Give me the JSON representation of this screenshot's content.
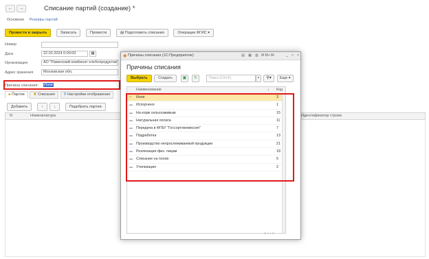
{
  "window": {
    "title": "Списание партий (создание) *",
    "tabs": [
      "Основное",
      "Резервы партий"
    ]
  },
  "toolbar": {
    "post_close": "Провести и закрыть",
    "save": "Записать",
    "post": "Провести",
    "prepare": "Подготовить списания",
    "fgis": "Операции ФГИС"
  },
  "form": {
    "number_label": "Номер",
    "number_value": "",
    "date_label": "Дата",
    "date_value": "22.02.2024 0:00:00",
    "org_label": "Организация",
    "org_value": "АО \"Раменский комбинат хлебопродуктов\"",
    "address_label": "Адрес хранения",
    "address_value": "Московская обл,",
    "reason_label": "Причина списания:",
    "reason_value": "Иное"
  },
  "subtabs": [
    "Партии",
    "Списания",
    "Настройки отображения"
  ],
  "grid_toolbar": {
    "add": "Добавить",
    "select_batches": "Подобрать партии"
  },
  "grid": {
    "col_n": "N",
    "col_nomenclature": "Номенклатура",
    "col_line_id": "Идентификатор строки"
  },
  "modal": {
    "window_title": "Причины списания (1С:Предприятие)",
    "window_buttons": "M M+ M-",
    "title": "Причины списания",
    "choose": "Выбрать",
    "create": "Создать",
    "search_placeholder": "Поиск (Ctrl+F)",
    "more": "Еще",
    "col_name": "Наименование",
    "col_code": "Код",
    "sort_marker": "↓",
    "rows": [
      {
        "name": "Иное",
        "code": "3"
      },
      {
        "name": "Испорчено",
        "code": "1"
      },
      {
        "name": "На корм сельхозживым",
        "code": "15"
      },
      {
        "name": "Натуральная оплата",
        "code": "11"
      },
      {
        "name": "Передача в ФГБУ \"Госсортокомиссия\"",
        "code": "7"
      },
      {
        "name": "Подработка",
        "code": "13"
      },
      {
        "name": "Производство непрослеживаемой продукции",
        "code": "21"
      },
      {
        "name": "Реализация физ. лицам",
        "code": "18"
      },
      {
        "name": "Списание на посев",
        "code": "5"
      },
      {
        "name": "Утилизация",
        "code": "2"
      }
    ]
  },
  "colors": {
    "accent_yellow": "#f5d400",
    "highlight_red": "#e01818",
    "selection_blue": "#3a6fd8",
    "selected_row": "#fbe8a6"
  }
}
